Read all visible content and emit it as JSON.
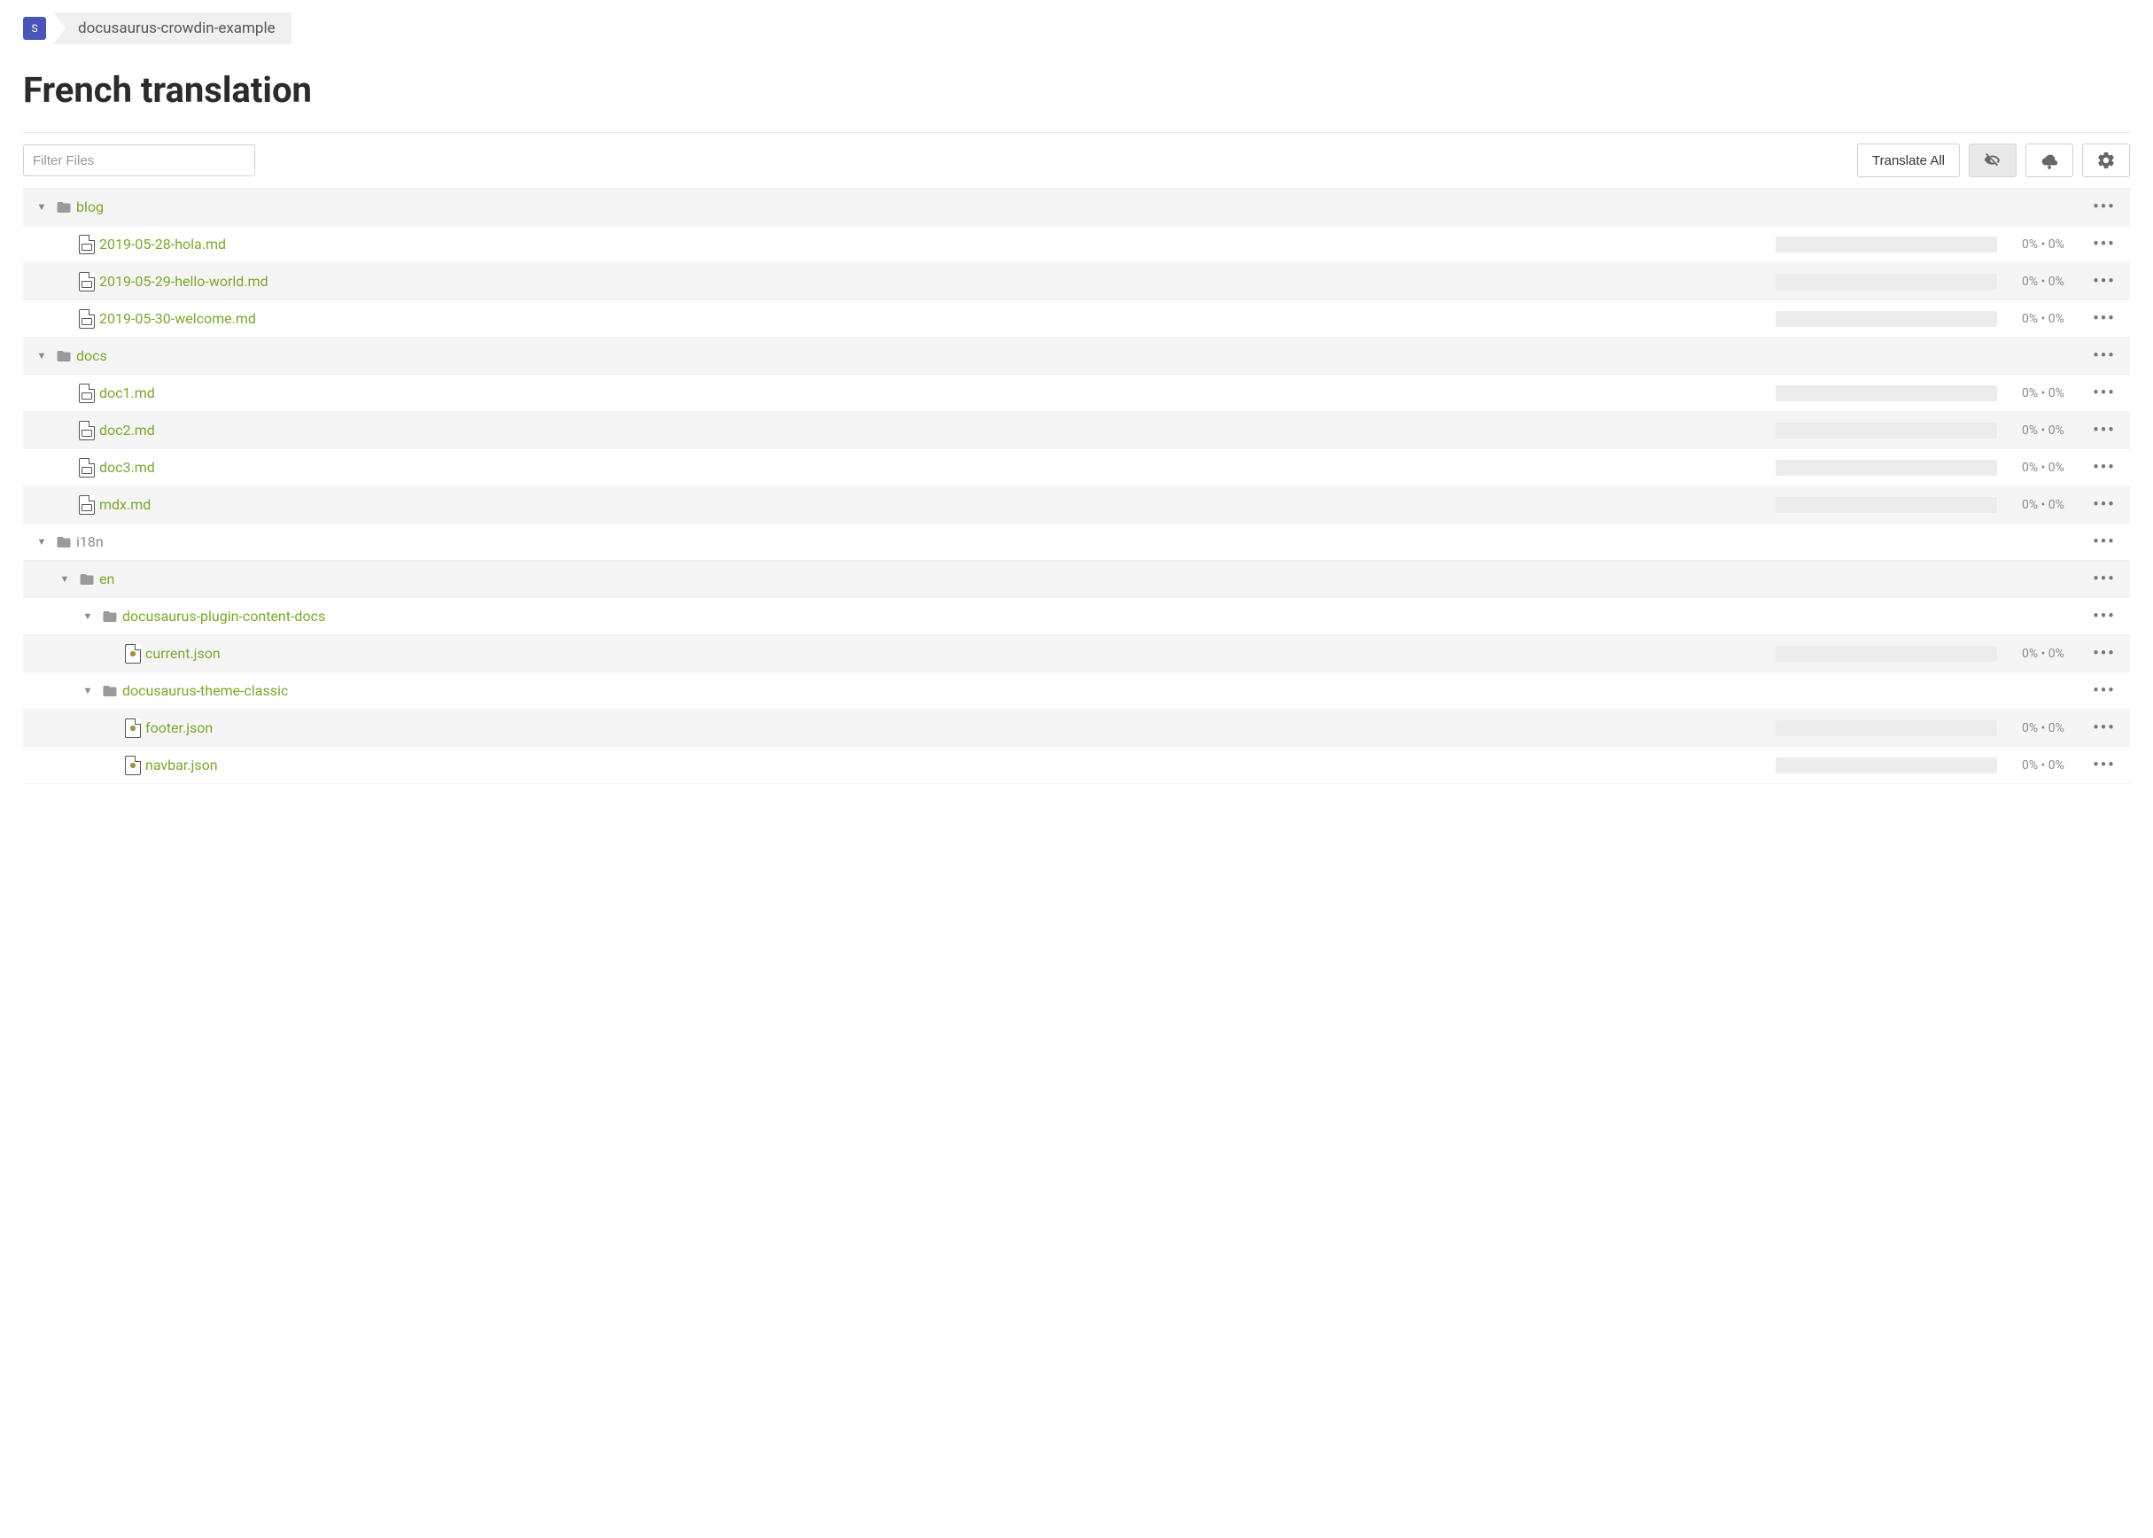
{
  "breadcrumb": {
    "avatar_letter": "S",
    "project": "docusaurus-crowdin-example"
  },
  "title": "French translation",
  "filter": {
    "placeholder": "Filter Files"
  },
  "toolbar": {
    "translate_all": "Translate All"
  },
  "percent_label": "0% • 0%",
  "rows": [
    {
      "type": "folder",
      "name": "blog",
      "depth": 0,
      "zebra": true,
      "caret": true,
      "dim": false
    },
    {
      "type": "md",
      "name": "2019-05-28-hola.md",
      "depth": 1,
      "zebra": false,
      "caret": false,
      "dim": false,
      "has_progress": true
    },
    {
      "type": "md",
      "name": "2019-05-29-hello-world.md",
      "depth": 1,
      "zebra": true,
      "caret": false,
      "dim": false,
      "has_progress": true
    },
    {
      "type": "md",
      "name": "2019-05-30-welcome.md",
      "depth": 1,
      "zebra": false,
      "caret": false,
      "dim": false,
      "has_progress": true
    },
    {
      "type": "folder",
      "name": "docs",
      "depth": 0,
      "zebra": true,
      "caret": true,
      "dim": false
    },
    {
      "type": "md",
      "name": "doc1.md",
      "depth": 1,
      "zebra": false,
      "caret": false,
      "dim": false,
      "has_progress": true
    },
    {
      "type": "md",
      "name": "doc2.md",
      "depth": 1,
      "zebra": true,
      "caret": false,
      "dim": false,
      "has_progress": true
    },
    {
      "type": "md",
      "name": "doc3.md",
      "depth": 1,
      "zebra": false,
      "caret": false,
      "dim": false,
      "has_progress": true
    },
    {
      "type": "md",
      "name": "mdx.md",
      "depth": 1,
      "zebra": true,
      "caret": false,
      "dim": false,
      "has_progress": true
    },
    {
      "type": "folder",
      "name": "i18n",
      "depth": 0,
      "zebra": false,
      "caret": true,
      "dim": true
    },
    {
      "type": "folder",
      "name": "en",
      "depth": 1,
      "zebra": true,
      "caret": true,
      "dim": false
    },
    {
      "type": "folder",
      "name": "docusaurus-plugin-content-docs",
      "depth": 2,
      "zebra": false,
      "caret": true,
      "dim": false
    },
    {
      "type": "json",
      "name": "current.json",
      "depth": 3,
      "zebra": true,
      "caret": false,
      "dim": false,
      "has_progress": true
    },
    {
      "type": "folder",
      "name": "docusaurus-theme-classic",
      "depth": 2,
      "zebra": false,
      "caret": true,
      "dim": false
    },
    {
      "type": "json",
      "name": "footer.json",
      "depth": 3,
      "zebra": true,
      "caret": false,
      "dim": false,
      "has_progress": true
    },
    {
      "type": "json",
      "name": "navbar.json",
      "depth": 3,
      "zebra": false,
      "caret": false,
      "dim": false,
      "has_progress": true
    }
  ]
}
